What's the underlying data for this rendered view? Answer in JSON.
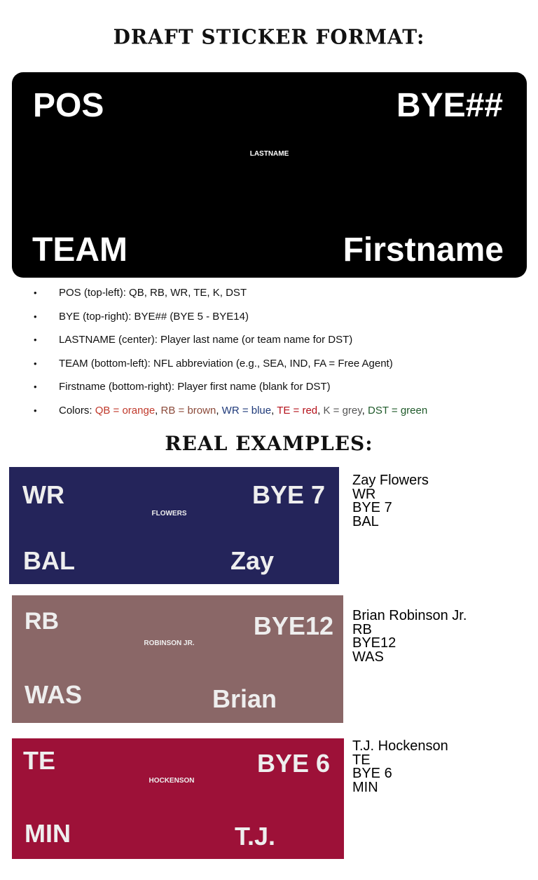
{
  "titles": {
    "format": "DRAFT STICKER FORMAT:",
    "examples": "REAL EXAMPLES:"
  },
  "template": {
    "pos": "POS",
    "bye": "BYE##",
    "lastname": "LASTNAME",
    "team": "TEAM",
    "firstname": "Firstname"
  },
  "notes": [
    "POS (top-left): QB, RB, WR, TE, K, DST",
    "BYE (top-right): BYE## (BYE 5 - BYE14)",
    "LASTNAME (center): Player last name (or team name for DST)",
    "TEAM (bottom-left): NFL abbreviation (e.g., SEA, IND, FA = Free Agent)",
    "Firstname (bottom-right): Player first name (blank for DST)"
  ],
  "colors_note": {
    "prefix": "Colors: ",
    "qb": "QB = orange",
    "rb": "RB = brown",
    "wr": "WR = blue",
    "te": "TE = red",
    "k": "K = grey",
    "dst": "DST = green",
    "sep": ", "
  },
  "bullet": "•",
  "examples": [
    {
      "pos": "WR",
      "bye": "BYE 7",
      "lastname": "FLOWERS",
      "team": "BAL",
      "firstname": "Zay",
      "color": "#24245a",
      "caption": [
        "Zay Flowers",
        "WR",
        "BYE 7",
        "BAL"
      ]
    },
    {
      "pos": "RB",
      "bye": "BYE12",
      "lastname": "ROBINSON JR.",
      "team": "WAS",
      "firstname": "Brian",
      "color": "#8a6767",
      "caption": [
        "Brian Robinson Jr.",
        "RB",
        "BYE12",
        "WAS"
      ]
    },
    {
      "pos": "TE",
      "bye": "BYE 6",
      "lastname": "HOCKENSON",
      "team": "MIN",
      "firstname": "T.J.",
      "color": "#9d1138",
      "caption": [
        "T.J. Hockenson",
        "TE",
        "BYE 6",
        "MIN"
      ]
    }
  ]
}
